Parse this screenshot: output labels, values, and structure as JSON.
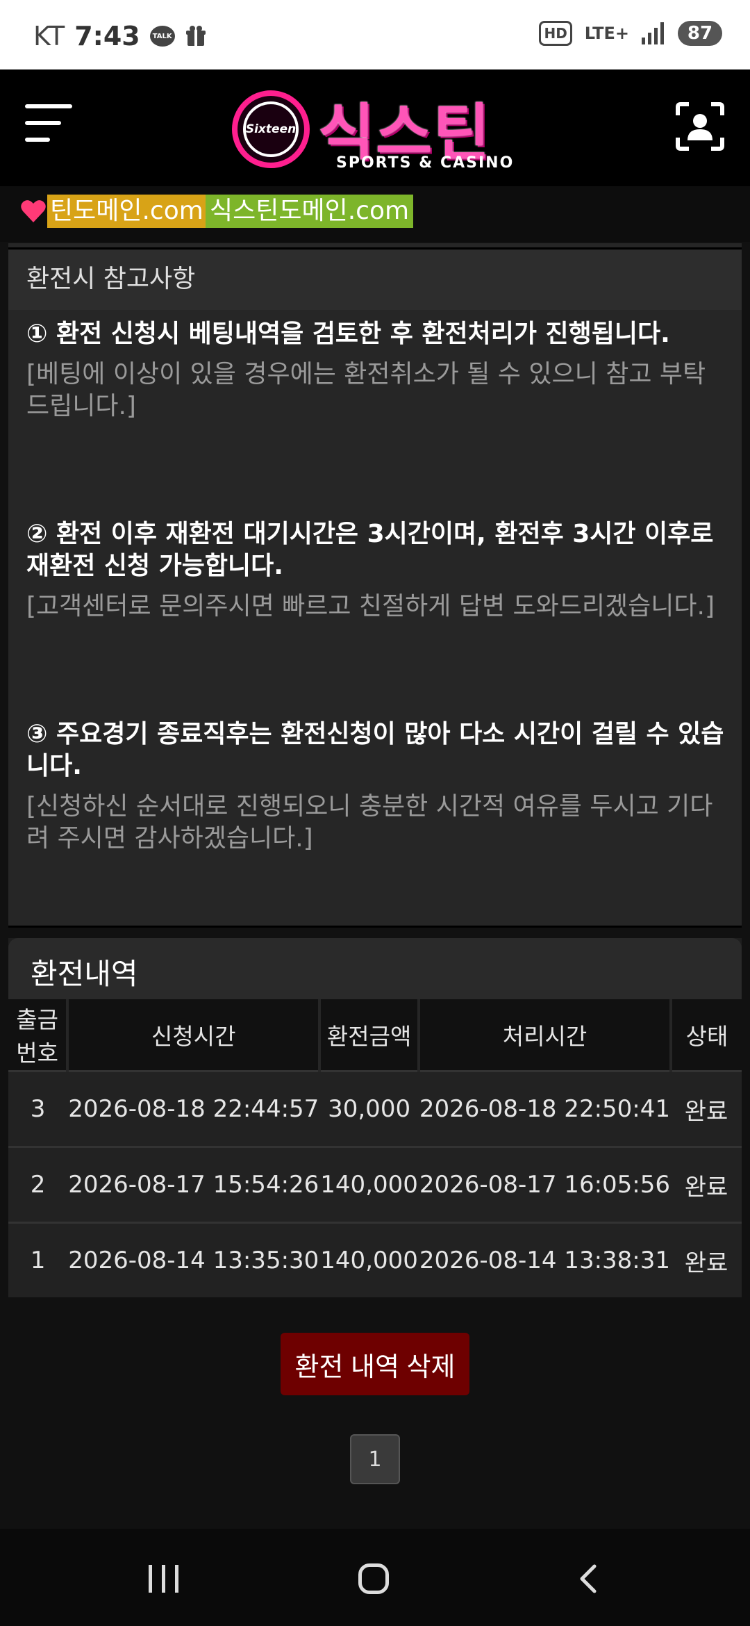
{
  "status_bar": {
    "carrier": "KT",
    "time": "7:43",
    "talk_label": "TALK",
    "hd": "HD",
    "network": "LTE+",
    "battery": "87"
  },
  "header": {
    "logo_small": "Sixteen",
    "logo_main": "식스틴",
    "logo_sub": "SPORTS & CASINO"
  },
  "domains": {
    "first": "틴도메인.com",
    "second": "식스틴도메인.com"
  },
  "notice": {
    "title": "환전시 참고사항",
    "items": [
      {
        "head": "① 환전 신청시 베팅내역을 검토한 후 환전처리가 진행됩니다.",
        "sub": "[베팅에 이상이 있을 경우에는 환전취소가 될 수 있으니 참고 부탁드립니다.]"
      },
      {
        "head": "② 환전 이후 재환전 대기시간은 3시간이며, 환전후 3시간 이후로 재환전 신청 가능합니다.",
        "sub": "[고객센터로 문의주시면 빠르고 친절하게 답변 도와드리겠습니다.]"
      },
      {
        "head": "③ 주요경기 종료직후는 환전신청이 많아 다소 시간이 걸릴 수 있습니다.",
        "sub": "[신청하신 순서대로 진행되오니 충분한 시간적 여유를 두시고 기다려 주시면 감사하겠습니다.]"
      }
    ]
  },
  "history": {
    "title": "환전내역",
    "columns": [
      "출금번호",
      "신청시간",
      "환전금액",
      "처리시간",
      "상태"
    ],
    "rows": [
      [
        "3",
        "2026-08-18 22:44:57",
        "30,000",
        "2026-08-18 22:50:41",
        "완료"
      ],
      [
        "2",
        "2026-08-17 15:54:26",
        "140,000",
        "2026-08-17 16:05:56",
        "완료"
      ],
      [
        "1",
        "2026-08-14 13:35:30",
        "140,000",
        "2026-08-14 13:38:31",
        "완료"
      ]
    ]
  },
  "actions": {
    "delete_label": "환전 내역 삭제",
    "page": "1"
  },
  "colors": {
    "brand_pink": "#ff1f8f",
    "delete_red": "#6e0000",
    "domain_yellow": "#d8a317",
    "domain_green": "#7db52a"
  }
}
